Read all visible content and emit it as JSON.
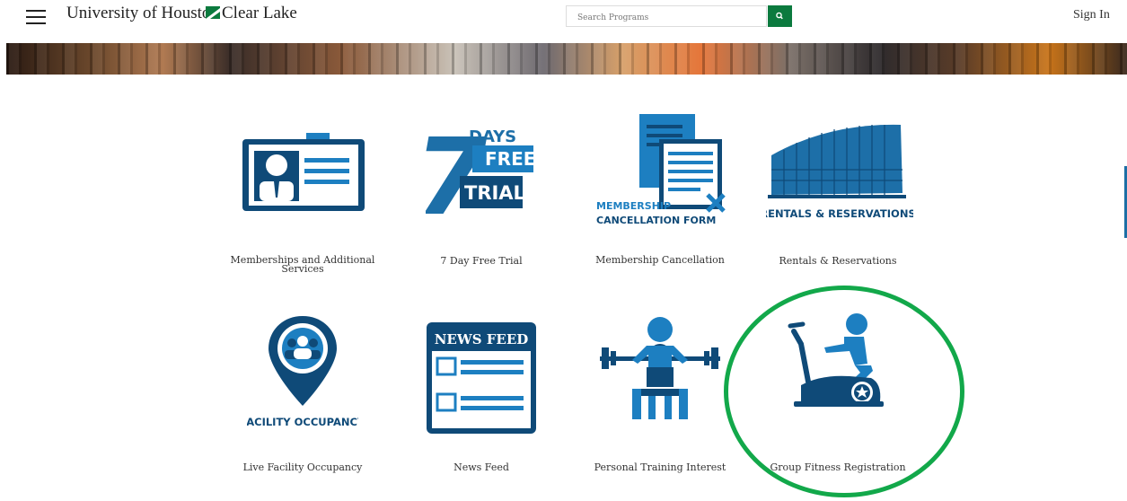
{
  "header": {
    "logo_part1": "University of Houston",
    "logo_part2": "Clear Lake",
    "search_placeholder": "Search Programs",
    "sign_in": "Sign In"
  },
  "icons": {
    "menu": "hamburger-icon",
    "search": "magnifier-icon"
  },
  "colors": {
    "icon_blue": "#1a5a8a",
    "icon_light_blue": "#1d7fc1",
    "brand_green": "#0b7a3e",
    "highlight_green": "#12a84a"
  },
  "tiles": [
    {
      "label": "Memberships and Additional Services",
      "icon_name": "id-card-icon"
    },
    {
      "label": "7 Day Free Trial",
      "icon_name": "seven-day-trial-icon",
      "icon_text": {
        "number": "7",
        "days": "DAYS",
        "free": "FREE",
        "trial": "TRIAL"
      }
    },
    {
      "label": "Membership Cancellation",
      "icon_name": "cancellation-form-icon",
      "icon_text": {
        "line1": "MEMBERSHIP",
        "line2": "CANCELLATION FORM"
      }
    },
    {
      "label": "Rentals & Reservations",
      "icon_name": "building-icon",
      "icon_text": {
        "line1": "RENTALS & RESERVATIONS"
      }
    },
    {
      "label": "Live Facility Occupancy",
      "icon_name": "occupancy-pin-icon",
      "icon_text": {
        "line1": "FACILITY OCCUPANCY"
      }
    },
    {
      "label": "News Feed",
      "icon_name": "news-feed-icon",
      "icon_text": {
        "line1": "NEWS FEED"
      }
    },
    {
      "label": "Personal Training Interest",
      "icon_name": "weightlifter-icon"
    },
    {
      "label": "Group Fitness Registration",
      "icon_name": "exercise-bike-icon"
    }
  ]
}
